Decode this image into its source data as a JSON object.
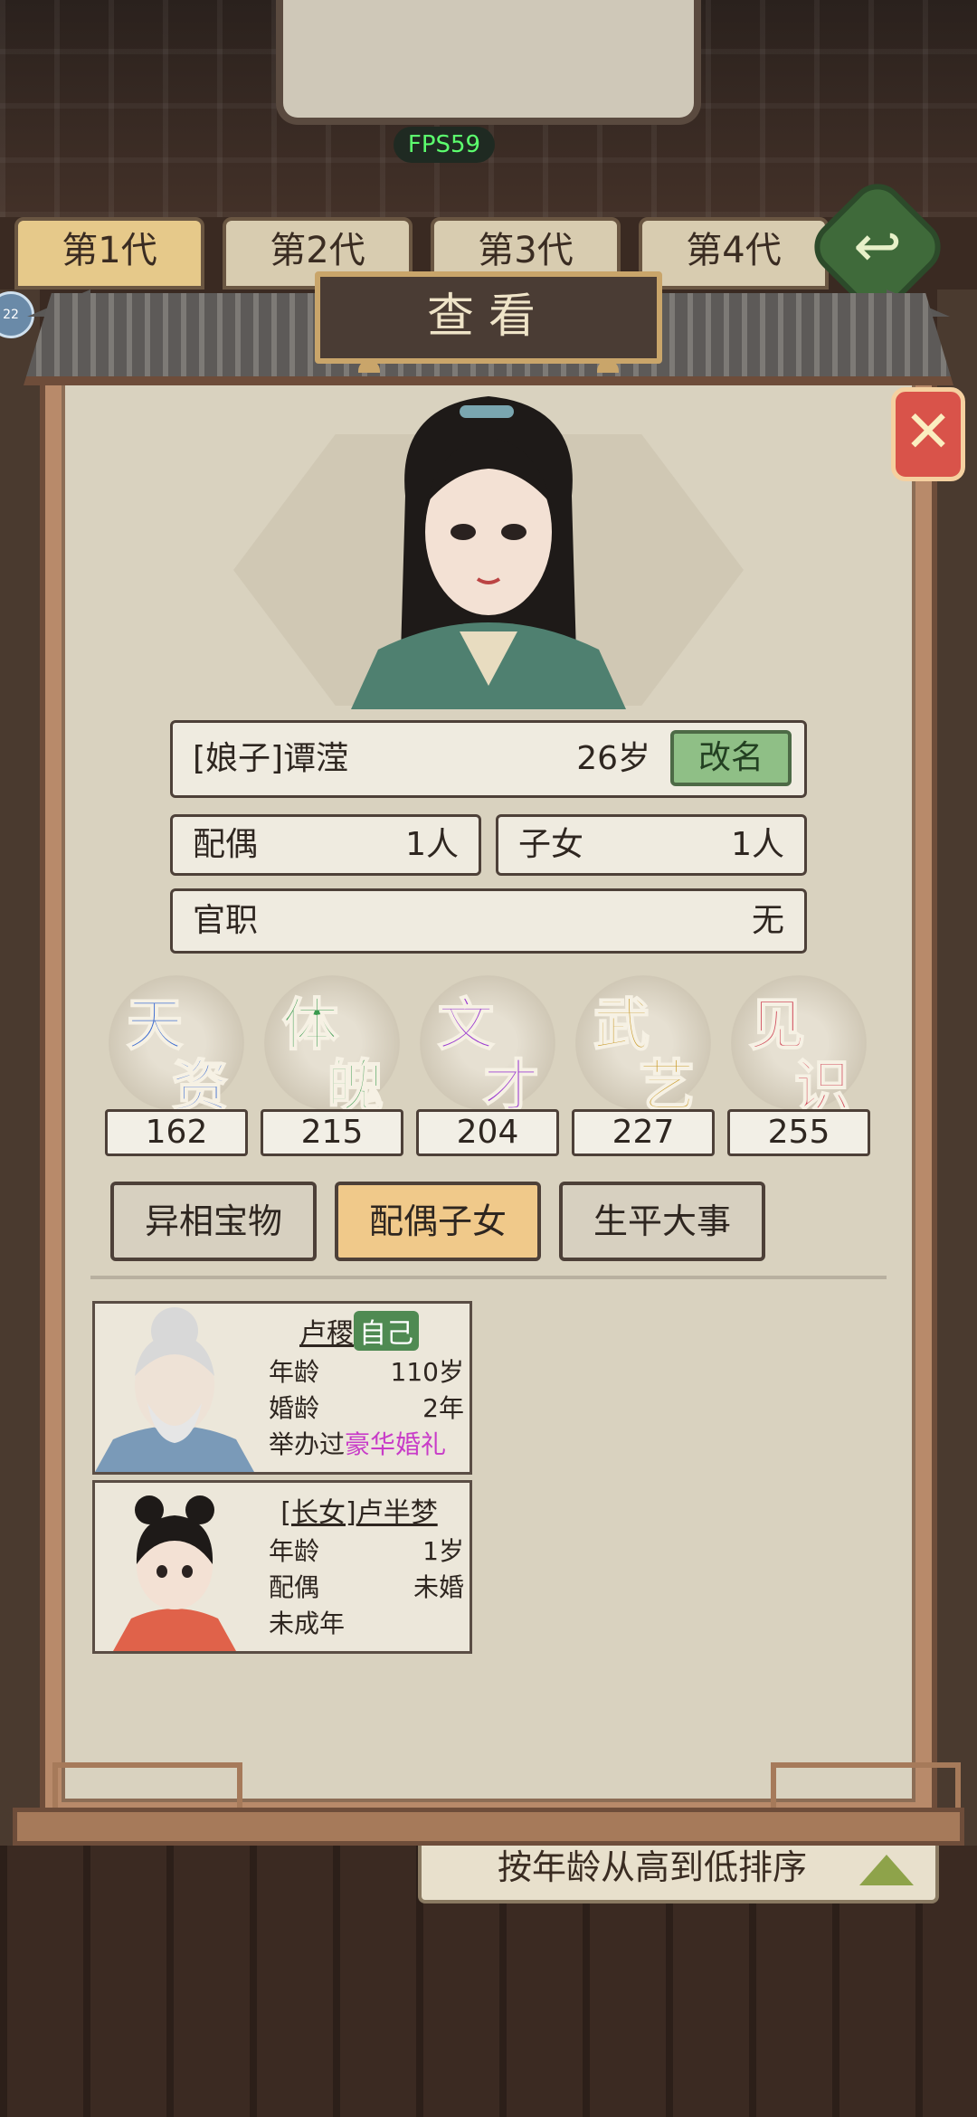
{
  "hud": {
    "fps": "FPS59",
    "badge": "22"
  },
  "generation_tabs": [
    "第1代",
    "第2代",
    "第3代",
    "第4代"
  ],
  "dialog": {
    "title": "查看"
  },
  "profile": {
    "name": "[娘子]谭滢",
    "age": "26岁",
    "rename_label": "改名",
    "spouse_label": "配偶",
    "spouse_value": "1人",
    "children_label": "子女",
    "children_value": "1人",
    "office_label": "官职",
    "office_value": "无"
  },
  "stats": [
    {
      "line1": "天",
      "line2": "资",
      "value": "162",
      "color": "#3a6ad0"
    },
    {
      "line1": "体",
      "line2": "魄",
      "value": "215",
      "color": "#3a9a4e"
    },
    {
      "line1": "文",
      "line2": "才",
      "value": "204",
      "color": "#9a3ad0"
    },
    {
      "line1": "武",
      "line2": "艺",
      "value": "227",
      "color": "#c89a2a"
    },
    {
      "line1": "见",
      "line2": "识",
      "value": "255",
      "color": "#d04a5a"
    }
  ],
  "tabs": [
    {
      "label": "异相宝物",
      "active": false
    },
    {
      "label": "配偶子女",
      "active": true
    },
    {
      "label": "生平大事",
      "active": false
    }
  ],
  "family": [
    {
      "name": "卢稷",
      "tag": "自己",
      "rows": [
        {
          "k": "年龄",
          "v": "110岁"
        },
        {
          "k": "婚龄",
          "v": "2年"
        }
      ],
      "note_prefix": "举办过",
      "note_highlight": "豪华婚礼"
    },
    {
      "name_prefix": "[长女]",
      "name": "卢半梦",
      "rows": [
        {
          "k": "年龄",
          "v": "1岁"
        },
        {
          "k": "配偶",
          "v": "未婚"
        }
      ],
      "note": "未成年"
    }
  ],
  "sort": {
    "label": "按年龄从高到低排序"
  },
  "colors": {
    "accent": "#f0c98a",
    "frame": "#6e4d3a",
    "panel": "#d9d2bf"
  }
}
